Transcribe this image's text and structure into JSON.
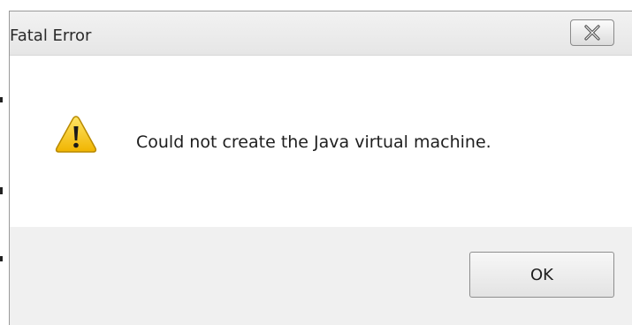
{
  "dialog": {
    "title": "Fatal Error",
    "message": "Could not create the Java virtual machine.",
    "ok_label": "OK",
    "close_icon": "close-icon",
    "status_icon": "warning-icon"
  },
  "colors": {
    "window_bg": "#f0f0f0",
    "content_bg": "#ffffff",
    "warning_yellow": "#f5c400",
    "link_blue": "#3366cc"
  }
}
